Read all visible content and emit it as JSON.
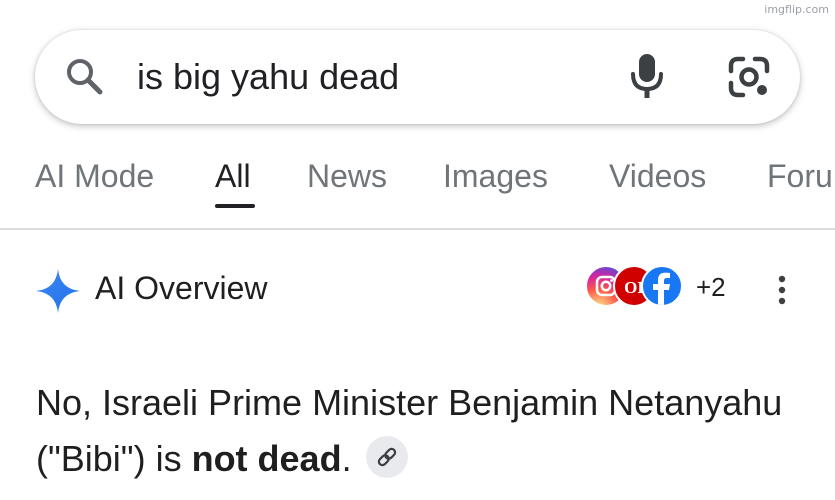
{
  "watermark": "imgflip.com",
  "search": {
    "query": "is big yahu dead",
    "icon": "search-icon",
    "mic_icon": "mic-icon",
    "lens_icon": "lens-icon"
  },
  "tabs": [
    {
      "label": "AI Mode",
      "active": false
    },
    {
      "label": "All",
      "active": true
    },
    {
      "label": "News",
      "active": false
    },
    {
      "label": "Images",
      "active": false
    },
    {
      "label": "Videos",
      "active": false
    },
    {
      "label": "Foru",
      "active": false
    }
  ],
  "ai_overview": {
    "title": "AI Overview",
    "icon": "sparkle-icon",
    "sources": {
      "icons": [
        "instagram-icon",
        "news-outlet-icon",
        "facebook-icon"
      ],
      "news_outlet_logo_text": "OI",
      "more_count": "+2"
    },
    "menu_icon": "kebab-icon",
    "answer": {
      "part1": "No, Israeli Prime Minister Benjamin Netanyahu (\"Bibi\") is ",
      "bold": "not dead",
      "part2": "."
    }
  },
  "colors": {
    "text_primary": "#1f1f1f",
    "text_secondary": "#70757a",
    "divider": "#dadce0",
    "sparkle_blue": "#4285f4",
    "facebook_blue": "#1877f2",
    "news_red": "#d00000"
  }
}
